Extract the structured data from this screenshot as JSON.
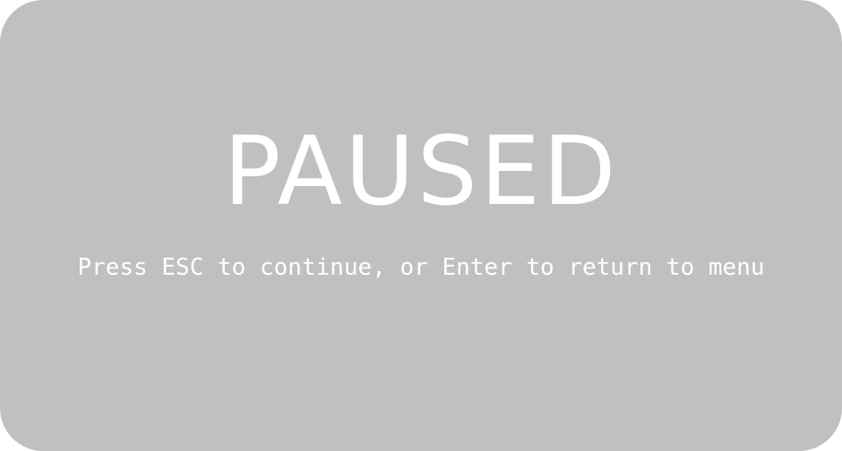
{
  "pause_screen": {
    "title": "PAUSED",
    "hint": "Press ESC to continue, or Enter to return to menu"
  },
  "colors": {
    "overlay": "#c0c0c0",
    "text": "#ffffff"
  }
}
